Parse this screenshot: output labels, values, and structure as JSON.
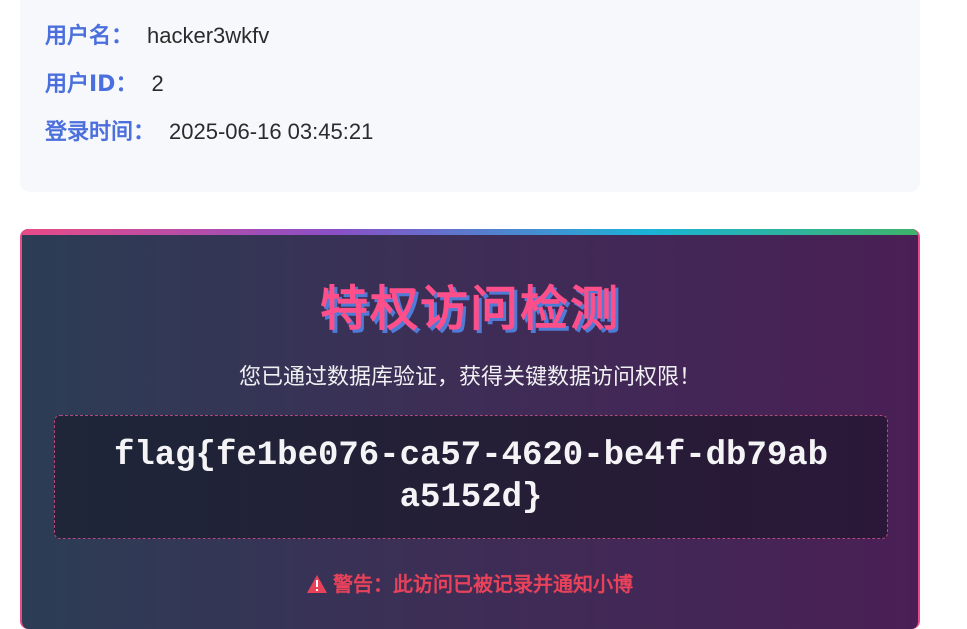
{
  "user_info": {
    "username_label": "用户名：",
    "username_value": "hacker3wkfv",
    "userid_label": "用户ID：",
    "userid_value": "2",
    "login_time_label": "登录时间：",
    "login_time_value": "2025-06-16 03:45:21"
  },
  "privilege_panel": {
    "title": "特权访问检测",
    "subtitle": "您已通过数据库验证，获得关键数据访问权限！",
    "flag": "flag{fe1be076-ca57-4620-be4f-db79aba5152d}",
    "warning_icon": "warning-triangle-icon",
    "warning_text": "警告：此访问已被记录并通知小博"
  },
  "colors": {
    "label_blue": "#4b6fdd",
    "title_pink": "#ff4f8a",
    "warning_red": "#e8425a"
  }
}
